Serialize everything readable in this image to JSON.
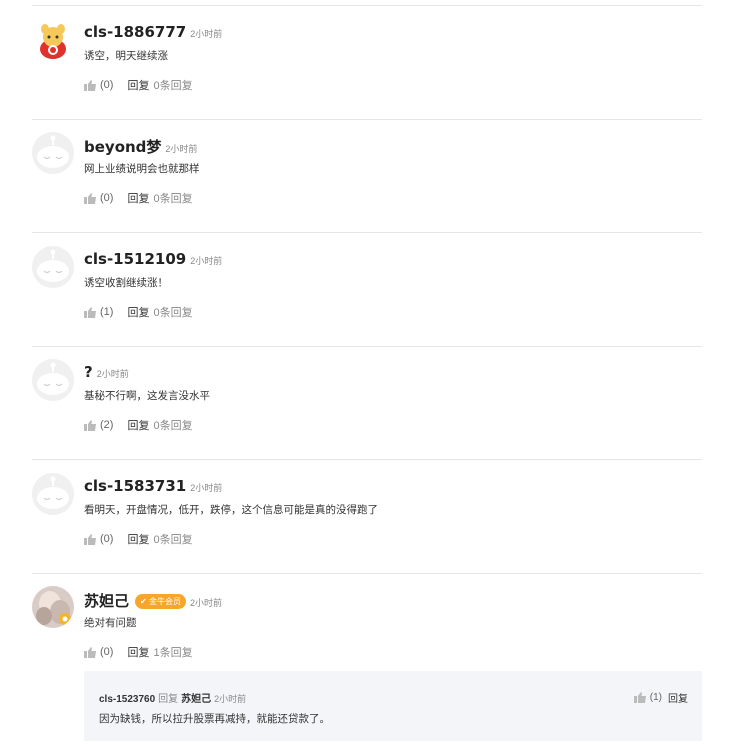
{
  "comments": [
    {
      "username": "cls-1886777",
      "time": "2小时前",
      "text": "诱空，明天继续涨",
      "likes": "(0)",
      "reply_label": "回复",
      "reply_count": "0条回复",
      "avatar": "mascot-avatar"
    },
    {
      "username": "beyond梦",
      "time": "2小时前",
      "text": "网上业绩说明会也就那样",
      "likes": "(0)",
      "reply_label": "回复",
      "reply_count": "0条回复",
      "avatar": "default-avatar"
    },
    {
      "username": "cls-1512109",
      "time": "2小时前",
      "text": "诱空收割继续涨！",
      "likes": "(1)",
      "reply_label": "回复",
      "reply_count": "0条回复",
      "avatar": "default-avatar"
    },
    {
      "username": "?",
      "time": "2小时前",
      "text": "基秘不行啊，这发言没水平",
      "likes": "(2)",
      "reply_label": "回复",
      "reply_count": "0条回复",
      "avatar": "default-avatar"
    },
    {
      "username": "cls-1583731",
      "time": "2小时前",
      "text": "看明天，开盘情况，低开，跌停，这个信息可能是真的没得跑了",
      "likes": "(0)",
      "reply_label": "回复",
      "reply_count": "0条回复",
      "avatar": "default-avatar"
    },
    {
      "username": "苏妲己",
      "badge": "金牛会员",
      "time": "2小时前",
      "text": "绝对有问题",
      "likes": "(0)",
      "reply_label": "回复",
      "reply_count": "1条回复",
      "avatar": "photo-avatar"
    }
  ],
  "sub_reply": {
    "username": "cls-1523760",
    "reply_word": "回复",
    "target": "苏妲己",
    "time": "2小时前",
    "text": "因为缺钱，所以拉升股票再减持，就能还贷款了。",
    "likes": "(1)",
    "reply_label": "回复"
  },
  "colors": {
    "divider": "#e6e6e6",
    "badge": "#f6a62b",
    "sub_bg": "#f4f5f8"
  }
}
